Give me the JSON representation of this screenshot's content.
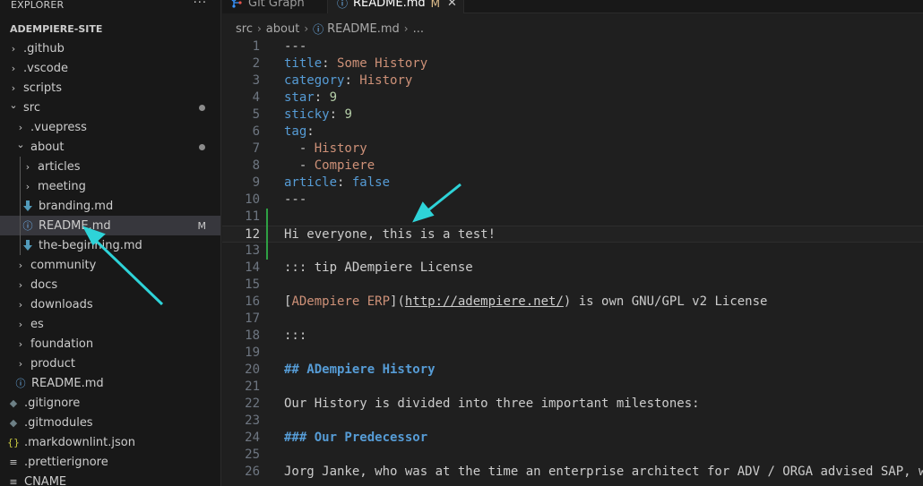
{
  "sidebar": {
    "header": "EXPLORER",
    "more": "···",
    "section_title": "ADEMPIERE-SITE",
    "items": [
      {
        "label": ".github",
        "twisty": "›",
        "icon": "",
        "badge": ""
      },
      {
        "label": ".vscode",
        "twisty": "›",
        "icon": "",
        "badge": ""
      },
      {
        "label": "scripts",
        "twisty": "›",
        "icon": "",
        "badge": ""
      },
      {
        "label": "src",
        "twisty": "⌄",
        "icon": "",
        "badge": ""
      },
      {
        "label": ".vuepress",
        "twisty": "›",
        "icon": "",
        "badge": ""
      },
      {
        "label": "about",
        "twisty": "⌄",
        "icon": "",
        "badge": ""
      },
      {
        "label": "articles",
        "twisty": "›",
        "icon": "",
        "badge": ""
      },
      {
        "label": "meeting",
        "twisty": "›",
        "icon": "",
        "badge": ""
      },
      {
        "label": "branding.md",
        "twisty": "",
        "icon": "markdown-icon",
        "badge": ""
      },
      {
        "label": "README.md",
        "twisty": "",
        "icon": "info-icon",
        "badge": "M"
      },
      {
        "label": "the-beginning.md",
        "twisty": "",
        "icon": "markdown-icon",
        "badge": ""
      },
      {
        "label": "community",
        "twisty": "›",
        "icon": "",
        "badge": ""
      },
      {
        "label": "docs",
        "twisty": "›",
        "icon": "",
        "badge": ""
      },
      {
        "label": "downloads",
        "twisty": "›",
        "icon": "",
        "badge": ""
      },
      {
        "label": "es",
        "twisty": "›",
        "icon": "",
        "badge": ""
      },
      {
        "label": "foundation",
        "twisty": "›",
        "icon": "",
        "badge": ""
      },
      {
        "label": "product",
        "twisty": "›",
        "icon": "",
        "badge": ""
      },
      {
        "label": "README.md",
        "twisty": "",
        "icon": "info-icon",
        "badge": ""
      },
      {
        "label": ".gitignore",
        "twisty": "",
        "icon": "git-icon",
        "badge": ""
      },
      {
        "label": ".gitmodules",
        "twisty": "",
        "icon": "git-icon",
        "badge": ""
      },
      {
        "label": ".markdownlint.json",
        "twisty": "",
        "icon": "json-icon",
        "badge": ""
      },
      {
        "label": ".prettierignore",
        "twisty": "",
        "icon": "lines-icon",
        "badge": ""
      },
      {
        "label": "CNAME",
        "twisty": "",
        "icon": "lines-icon",
        "badge": ""
      }
    ]
  },
  "tabs": [
    {
      "label": "Git Graph",
      "icon": "git-graph-icon",
      "modified": "",
      "close": ""
    },
    {
      "label": "README.md",
      "icon": "info-icon",
      "modified": "M",
      "close": "✕"
    }
  ],
  "breadcrumb": {
    "items": [
      "src",
      "about",
      "README.md",
      "..."
    ]
  },
  "editor": {
    "lines": [
      {
        "n": "1",
        "segs": [
          {
            "t": "---",
            "c": ""
          }
        ]
      },
      {
        "n": "2",
        "segs": [
          {
            "t": "title",
            "c": "k"
          },
          {
            "t": ": ",
            "c": ""
          },
          {
            "t": "Some History",
            "c": "s"
          }
        ]
      },
      {
        "n": "3",
        "segs": [
          {
            "t": "category",
            "c": "k"
          },
          {
            "t": ": ",
            "c": ""
          },
          {
            "t": "History",
            "c": "s"
          }
        ]
      },
      {
        "n": "4",
        "segs": [
          {
            "t": "star",
            "c": "k"
          },
          {
            "t": ": ",
            "c": ""
          },
          {
            "t": "9",
            "c": "n"
          }
        ]
      },
      {
        "n": "5",
        "segs": [
          {
            "t": "sticky",
            "c": "k"
          },
          {
            "t": ": ",
            "c": ""
          },
          {
            "t": "9",
            "c": "n"
          }
        ]
      },
      {
        "n": "6",
        "segs": [
          {
            "t": "tag",
            "c": "k"
          },
          {
            "t": ":",
            "c": ""
          }
        ]
      },
      {
        "n": "7",
        "segs": [
          {
            "t": "  - ",
            "c": ""
          },
          {
            "t": "History",
            "c": "s"
          }
        ]
      },
      {
        "n": "8",
        "segs": [
          {
            "t": "  - ",
            "c": ""
          },
          {
            "t": "Compiere",
            "c": "s"
          }
        ]
      },
      {
        "n": "9",
        "segs": [
          {
            "t": "article",
            "c": "k"
          },
          {
            "t": ": ",
            "c": ""
          },
          {
            "t": "false",
            "c": "k"
          }
        ]
      },
      {
        "n": "10",
        "segs": [
          {
            "t": "---",
            "c": ""
          }
        ]
      },
      {
        "n": "11",
        "segs": []
      },
      {
        "n": "12",
        "segs": [
          {
            "t": "Hi everyone, this is a test!",
            "c": ""
          }
        ]
      },
      {
        "n": "13",
        "segs": []
      },
      {
        "n": "14",
        "segs": [
          {
            "t": "::: tip ADempiere License",
            "c": ""
          }
        ]
      },
      {
        "n": "15",
        "segs": []
      },
      {
        "n": "16",
        "segs": [
          {
            "t": "[",
            "c": ""
          },
          {
            "t": "ADempiere ERP",
            "c": "s"
          },
          {
            "t": "](",
            "c": ""
          },
          {
            "t": "http://adempiere.net/",
            "c": "u"
          },
          {
            "t": ") is own GNU/GPL v2 License",
            "c": ""
          }
        ]
      },
      {
        "n": "17",
        "segs": []
      },
      {
        "n": "18",
        "segs": [
          {
            "t": ":::",
            "c": ""
          }
        ]
      },
      {
        "n": "19",
        "segs": []
      },
      {
        "n": "20",
        "segs": [
          {
            "t": "## ADempiere History",
            "c": "h"
          }
        ]
      },
      {
        "n": "21",
        "segs": []
      },
      {
        "n": "22",
        "segs": [
          {
            "t": "Our History is divided into three important milestones:",
            "c": ""
          }
        ]
      },
      {
        "n": "23",
        "segs": []
      },
      {
        "n": "24",
        "segs": [
          {
            "t": "### Our Predecessor",
            "c": "h"
          }
        ]
      },
      {
        "n": "25",
        "segs": []
      },
      {
        "n": "26",
        "segs": [
          {
            "t": "Jorg Janke, who was at the time an enterprise architect for ADV / ORGA advised SAP, w",
            "c": ""
          }
        ]
      }
    ],
    "current_line": "12"
  },
  "colors": {
    "accent_arrow": "#2ed3d8",
    "git_modified": "#e2c08d",
    "git_added_bar": "#2ea043",
    "info_icon": "#75beff",
    "markdown_icon": "#519aba"
  }
}
